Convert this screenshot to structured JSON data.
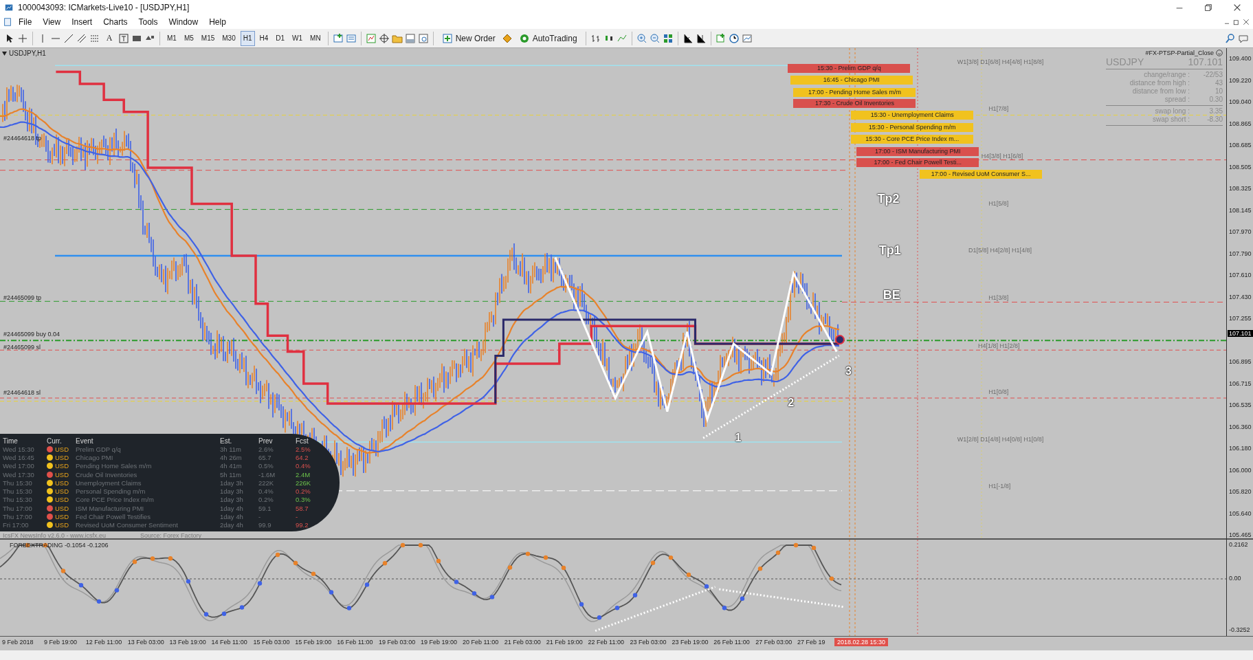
{
  "window": {
    "title": "1000043093: ICMarkets-Live10 - [USDJPY,H1]"
  },
  "menu": [
    "File",
    "View",
    "Insert",
    "Charts",
    "Tools",
    "Window",
    "Help"
  ],
  "toolbar": {
    "text_tool": "A",
    "timeframes": [
      {
        "label": "M1",
        "selected": false
      },
      {
        "label": "M5",
        "selected": false
      },
      {
        "label": "M15",
        "selected": false
      },
      {
        "label": "M30",
        "selected": false
      },
      {
        "label": "H1",
        "selected": true
      },
      {
        "label": "H4",
        "selected": false
      },
      {
        "label": "D1",
        "selected": false
      },
      {
        "label": "W1",
        "selected": false
      },
      {
        "label": "MN",
        "selected": false
      }
    ],
    "new_order": "New Order",
    "autotrading": "AutoTrading"
  },
  "chart": {
    "symbol": "USDJPY,H1",
    "order_labels": [
      "#24464618 tp",
      "#24465099 tp",
      "#24465099 buy 0.04",
      "#24465099 sl",
      "#24464618 sl"
    ],
    "events": [
      {
        "text": "15:30 - Prelim GDP q/q",
        "color": "#d9504d"
      },
      {
        "text": "16:45 - Chicago PMI",
        "color": "#f1c21e"
      },
      {
        "text": "17:00 - Pending Home Sales m/m",
        "color": "#f1c21e"
      },
      {
        "text": "17:30 - Crude Oil Inventories",
        "color": "#d9504d"
      },
      {
        "text": "15:30 - Unemployment Claims",
        "color": "#f1c21e"
      },
      {
        "text": "15:30 - Personal Spending m/m",
        "color": "#f1c21e"
      },
      {
        "text": "15:30 - Core PCE Price Index m...",
        "color": "#f1c21e"
      },
      {
        "text": "17:00 - ISM Manufacturing PMI",
        "color": "#d9504d"
      },
      {
        "text": "17:00 - Fed Chair Powell Testi...",
        "color": "#d9504d"
      },
      {
        "text": "17:00 - Revised UoM Consumer S...",
        "color": "#f1c21e"
      }
    ],
    "pivot_labels": [
      "W1[3/8] D1[6/8] H4[4/8] H1[8/8]",
      "H1[7/8]",
      "H4[3/8] H1[6/8]",
      "H1[5/8]",
      "D1[5/8] H4[2/8] H1[4/8]",
      "H1[3/8]",
      "H4[1/8] H1[2/8]",
      "H1[0/8]",
      "W1[2/8] D1[4/8] H4[0/8] H1[0/8]",
      "H1[-1/8]"
    ],
    "targets": [
      "Tp2",
      "Tp1",
      "BE"
    ],
    "wave_numbers": [
      "1",
      "2",
      "3"
    ],
    "info": {
      "title": "#FX-PTSP-Partial_Close",
      "symbol": "USDJPY",
      "price": "107.101",
      "rows": [
        {
          "label": "change/range :",
          "value": "-22/53"
        },
        {
          "label": "distance from high :",
          "value": "43"
        },
        {
          "label": "distance from low :",
          "value": "10"
        },
        {
          "label": "spread :",
          "value": "0.30"
        }
      ],
      "swap_rows": [
        {
          "label": "swap long :",
          "value": "3.35"
        },
        {
          "label": "swap short :",
          "value": "-8.30"
        }
      ]
    }
  },
  "news": {
    "columns": [
      "Time",
      "Curr.",
      "Event",
      "Est.",
      "Prev",
      "Fcst"
    ],
    "rows": [
      {
        "time": "Wed 15:30",
        "color": "#e0504a",
        "currency": "USD",
        "event": "Prelim GDP q/q",
        "est": "3h 11m",
        "prev": "2.6%",
        "fcst": "2.5%",
        "better": false
      },
      {
        "time": "Wed 16:45",
        "color": "#f1c21e",
        "currency": "USD",
        "event": "Chicago PMI",
        "est": "4h 26m",
        "prev": "65.7",
        "fcst": "64.2",
        "better": false
      },
      {
        "time": "Wed 17:00",
        "color": "#f1c21e",
        "currency": "USD",
        "event": "Pending Home Sales m/m",
        "est": "4h 41m",
        "prev": "0.5%",
        "fcst": "0.4%",
        "better": false
      },
      {
        "time": "Wed 17:30",
        "color": "#e0504a",
        "currency": "USD",
        "event": "Crude Oil Inventories",
        "est": "5h 11m",
        "prev": "-1.6M",
        "fcst": "2.4M",
        "better": true
      },
      {
        "time": "Thu 15:30",
        "color": "#f1c21e",
        "currency": "USD",
        "event": "Unemployment Claims",
        "est": "1day 3h",
        "prev": "222K",
        "fcst": "226K",
        "better": true
      },
      {
        "time": "Thu 15:30",
        "color": "#f1c21e",
        "currency": "USD",
        "event": "Personal Spending m/m",
        "est": "1day 3h",
        "prev": "0.4%",
        "fcst": "0.2%",
        "better": false
      },
      {
        "time": "Thu 15:30",
        "color": "#f1c21e",
        "currency": "USD",
        "event": "Core PCE Price Index m/m",
        "est": "1day 3h",
        "prev": "0.2%",
        "fcst": "0.3%",
        "better": true
      },
      {
        "time": "Thu 17:00",
        "color": "#e0504a",
        "currency": "USD",
        "event": "ISM Manufacturing PMI",
        "est": "1day 4h",
        "prev": "59.1",
        "fcst": "58.7",
        "better": false
      },
      {
        "time": "Thu 17:00",
        "color": "#e0504a",
        "currency": "USD",
        "event": "Fed Chair Powell Testifies",
        "est": "1day 4h",
        "prev": "-",
        "fcst": "-",
        "better": false
      },
      {
        "time": "Fri 17:00",
        "color": "#f1c21e",
        "currency": "USD",
        "event": "Revised UoM Consumer Sentiment",
        "est": "2day 4h",
        "prev": "99.9",
        "fcst": "99.2",
        "better": false
      }
    ],
    "footer": "IcsFX NewsInfo v2.6.0  -  www.icsfx.eu",
    "source": "Source: Forex Factory"
  },
  "indicator": {
    "label": "FORBEXTRADING -0.1054 -0.1206",
    "axis": [
      "0.2162",
      "0.00",
      "-0.3252"
    ]
  },
  "price_axis": {
    "labels": [
      "109.400",
      "109.220",
      "109.040",
      "108.865",
      "108.685",
      "108.505",
      "108.325",
      "108.145",
      "107.970",
      "107.790",
      "107.610",
      "107.430",
      "107.255",
      "106.895",
      "106.715",
      "106.535",
      "106.360",
      "106.180",
      "106.000",
      "105.820",
      "105.640",
      "105.465"
    ],
    "current": "107.101"
  },
  "time_axis": {
    "labels": [
      "9 Feb 2018",
      "9 Feb 19:00",
      "12 Feb 11:00",
      "13 Feb 03:00",
      "13 Feb 19:00",
      "14 Feb 11:00",
      "15 Feb 03:00",
      "15 Feb 19:00",
      "16 Feb 11:00",
      "19 Feb 03:00",
      "19 Feb 19:00",
      "20 Feb 11:00",
      "21 Feb 03:00",
      "21 Feb 19:00",
      "22 Feb 11:00",
      "23 Feb 03:00",
      "23 Feb 19:00",
      "26 Feb 11:00",
      "27 Feb 03:00",
      "27 Feb 19"
    ],
    "cursor": "2018.02.28 15:30"
  }
}
